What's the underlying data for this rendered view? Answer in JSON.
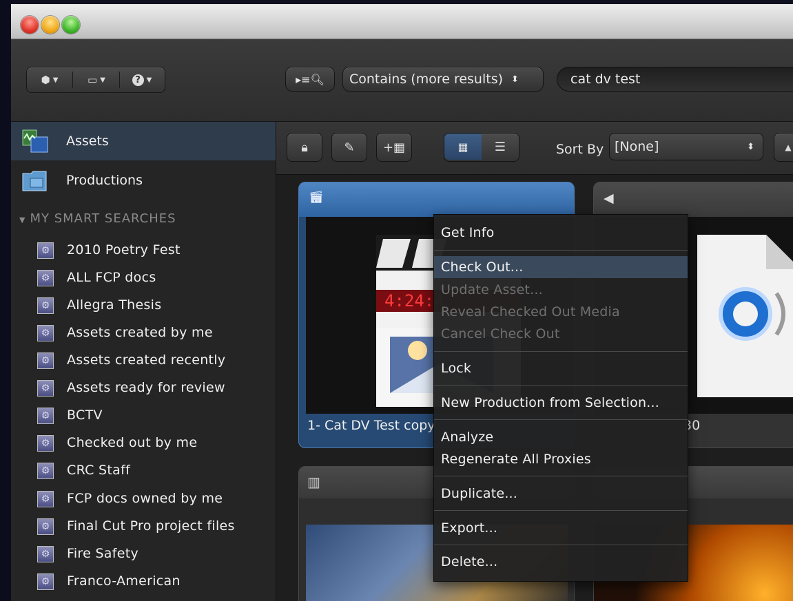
{
  "toolbar": {
    "scope_menu": "Contains (more results)",
    "search_value": "cat dv test"
  },
  "sidebar": {
    "top_items": [
      {
        "label": "Assets"
      },
      {
        "label": "Productions"
      }
    ],
    "section_title": "MY SMART SEARCHES",
    "smart_searches": [
      "2010 Poetry Fest",
      "ALL FCP docs",
      "Allegra Thesis",
      "Assets created by me",
      "Assets created recently",
      "Assets ready for review",
      "BCTV",
      "Checked out by me",
      "CRC Staff",
      "FCP docs owned by me",
      "Final Cut Pro project files",
      "Fire Safety",
      "Franco-American"
    ]
  },
  "content": {
    "sort_label": "Sort By",
    "sort_value": "[None]",
    "asset_card_label": "1- Cat DV Test copy",
    "asset_card2_fragment": "30"
  },
  "context_menu": {
    "items": [
      {
        "label": "Get Info",
        "enabled": true
      },
      {
        "label": "Check Out...",
        "enabled": true,
        "highlighted": true
      },
      {
        "label": "Update Asset...",
        "enabled": false
      },
      {
        "label": "Reveal Checked Out Media",
        "enabled": false
      },
      {
        "label": "Cancel Check Out",
        "enabled": false
      },
      {
        "label": "Lock",
        "enabled": true
      },
      {
        "label": "New Production from Selection...",
        "enabled": true
      },
      {
        "label": "Analyze",
        "enabled": true
      },
      {
        "label": "Regenerate All Proxies",
        "enabled": true
      },
      {
        "label": "Duplicate...",
        "enabled": true
      },
      {
        "label": "Export...",
        "enabled": true
      },
      {
        "label": "Delete...",
        "enabled": true
      }
    ]
  },
  "colors": {
    "selection": "#2f3c4c",
    "selected_card": "#264a73",
    "menu_highlight": "#3a4a5c"
  }
}
